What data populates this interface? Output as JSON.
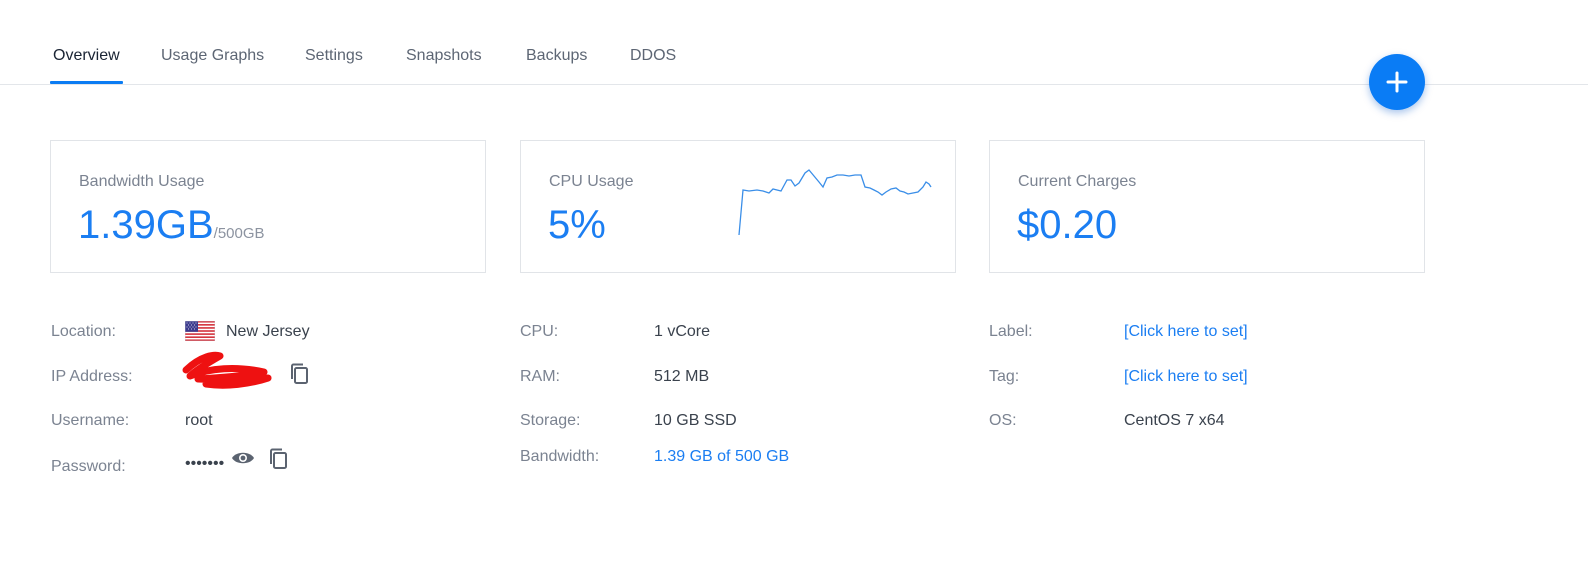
{
  "tabs": [
    {
      "label": "Overview",
      "active": true
    },
    {
      "label": "Usage Graphs",
      "active": false
    },
    {
      "label": "Settings",
      "active": false
    },
    {
      "label": "Snapshots",
      "active": false
    },
    {
      "label": "Backups",
      "active": false
    },
    {
      "label": "DDOS",
      "active": false
    }
  ],
  "fab": {
    "icon": "plus-icon"
  },
  "cards": {
    "bandwidth": {
      "label": "Bandwidth Usage",
      "value": "1.39GB",
      "sub": "/500GB"
    },
    "cpu": {
      "label": "CPU Usage",
      "value": "5%",
      "sparkline_icon": "cpu-sparkline"
    },
    "charges": {
      "label": "Current Charges",
      "value": "$0.20"
    }
  },
  "info": {
    "location_label": "Location:",
    "location_value": "New Jersey",
    "location_icon": "us-flag-icon",
    "ip_label": "IP Address:",
    "username_label": "Username:",
    "username_value": "root",
    "password_label": "Password:",
    "password_value": "•••••••",
    "cpu_label": "CPU:",
    "cpu_value": "1 vCore",
    "ram_label": "RAM:",
    "ram_value": "512 MB",
    "storage_label": "Storage:",
    "storage_value": "10 GB SSD",
    "bandwidth_label": "Bandwidth:",
    "bandwidth_value": "1.39 GB of 500 GB",
    "label_label": "Label:",
    "label_value": "[Click here to set]",
    "tag_label": "Tag:",
    "tag_value": "[Click here to set]",
    "os_label": "OS:",
    "os_value": "CentOS 7 x64"
  },
  "colors": {
    "accent": "#1b7ef2",
    "fab": "#0a7cf5",
    "redaction": "#ee1111"
  }
}
